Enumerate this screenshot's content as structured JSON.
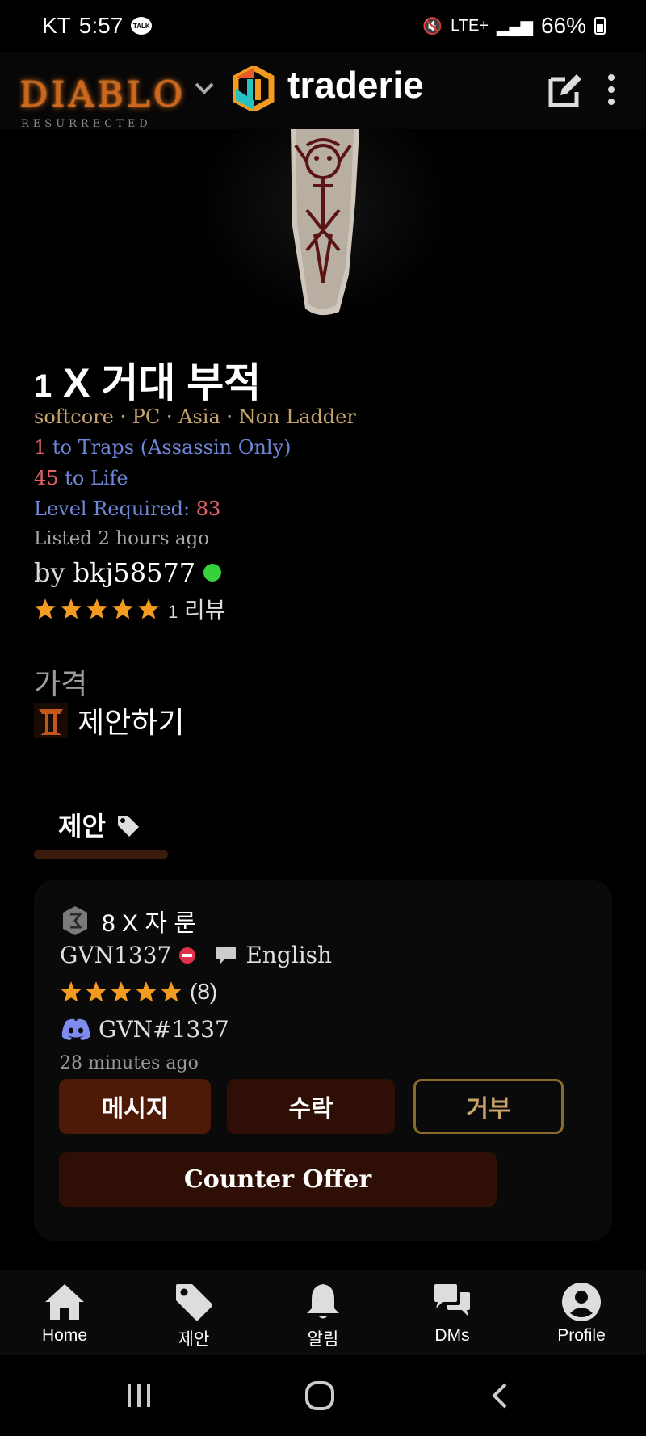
{
  "status_bar": {
    "carrier": "KT",
    "time": "5:57",
    "talk_badge": "TALK",
    "network": "LTE+",
    "battery": "66%"
  },
  "header": {
    "game_logo_title": "DIABLO",
    "game_logo_subtitle": "RESURRECTED",
    "brand": "traderie"
  },
  "item": {
    "qty": "1",
    "title": "X 거대 부적",
    "meta": "softcore · PC · Asia · Non Ladder",
    "properties": [
      {
        "value": "1",
        "text": " to Traps (Assassin Only)"
      },
      {
        "value": "45",
        "text": " to Life"
      },
      {
        "label": "Level Required: ",
        "value": "83"
      }
    ],
    "listed": "Listed 2 hours ago",
    "by_prefix": "by",
    "seller": "bkj58577",
    "review_count": "1",
    "review_label": "리뷰"
  },
  "price": {
    "label": "가격",
    "offer_now": "제안하기"
  },
  "tabs": {
    "offers_label": "제안"
  },
  "offer": {
    "item": "8 X 자 룬",
    "user": "GVN1337",
    "language": "English",
    "rating_count": "(8)",
    "discord": "GVN#1337",
    "time": "28 minutes ago",
    "buttons": {
      "message": "메시지",
      "accept": "수락",
      "decline": "거부",
      "counter": "Counter Offer"
    }
  },
  "bottom_nav": {
    "home": "Home",
    "offers": "제안",
    "notifications": "알림",
    "dms": "DMs",
    "profile": "Profile"
  },
  "colors": {
    "background": "#000000",
    "gold": "#c6a36d",
    "magic_blue": "#6e86d6",
    "value_red": "#e2646a",
    "star": "#f39a21",
    "online": "#37d13b",
    "button_dark": "#2f0f05"
  }
}
